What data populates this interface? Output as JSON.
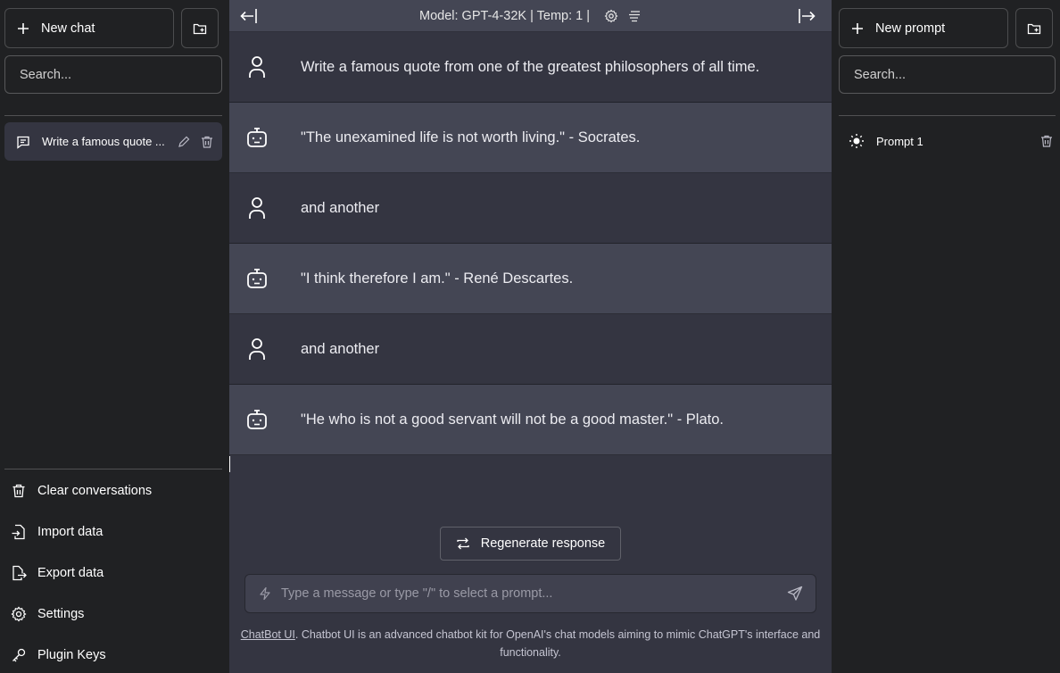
{
  "colors": {
    "sidebar_bg": "#202123",
    "main_bg": "#343541",
    "bot_bg": "#444654",
    "input_bg": "#40414f"
  },
  "left_sidebar": {
    "new_chat_label": "New chat",
    "search_placeholder": "Search...",
    "conversations": [
      {
        "title": "Write a famous quote ..."
      }
    ],
    "bottom_menu": [
      {
        "label": "Clear conversations",
        "icon": "trash-icon"
      },
      {
        "label": "Import data",
        "icon": "file-import-icon"
      },
      {
        "label": "Export data",
        "icon": "file-export-icon"
      },
      {
        "label": "Settings",
        "icon": "gear-icon"
      },
      {
        "label": "Plugin Keys",
        "icon": "key-icon"
      }
    ]
  },
  "right_sidebar": {
    "new_prompt_label": "New prompt",
    "search_placeholder": "Search...",
    "prompts": [
      {
        "name": "Prompt 1"
      }
    ]
  },
  "header": {
    "model_info": "Model: GPT-4-32K | Temp: 1 |"
  },
  "messages": [
    {
      "role": "user",
      "text": "Write a famous quote from one of the greatest philosophers of all time."
    },
    {
      "role": "assistant",
      "text": "\"The unexamined life is not worth living.\" - Socrates."
    },
    {
      "role": "user",
      "text": "and another"
    },
    {
      "role": "assistant",
      "text": "\"I think therefore I am.\" - René Descartes."
    },
    {
      "role": "user",
      "text": "and another"
    },
    {
      "role": "assistant",
      "text": "\"He who is not a good servant will not be a good master.\" - Plato."
    }
  ],
  "regenerate_label": "Regenerate response",
  "composer": {
    "placeholder": "Type a message or type \"/\" to select a prompt..."
  },
  "footer": {
    "link_text": "ChatBot UI",
    "text": ". Chatbot UI is an advanced chatbot kit for OpenAI's chat models aiming to mimic ChatGPT's interface and functionality."
  }
}
